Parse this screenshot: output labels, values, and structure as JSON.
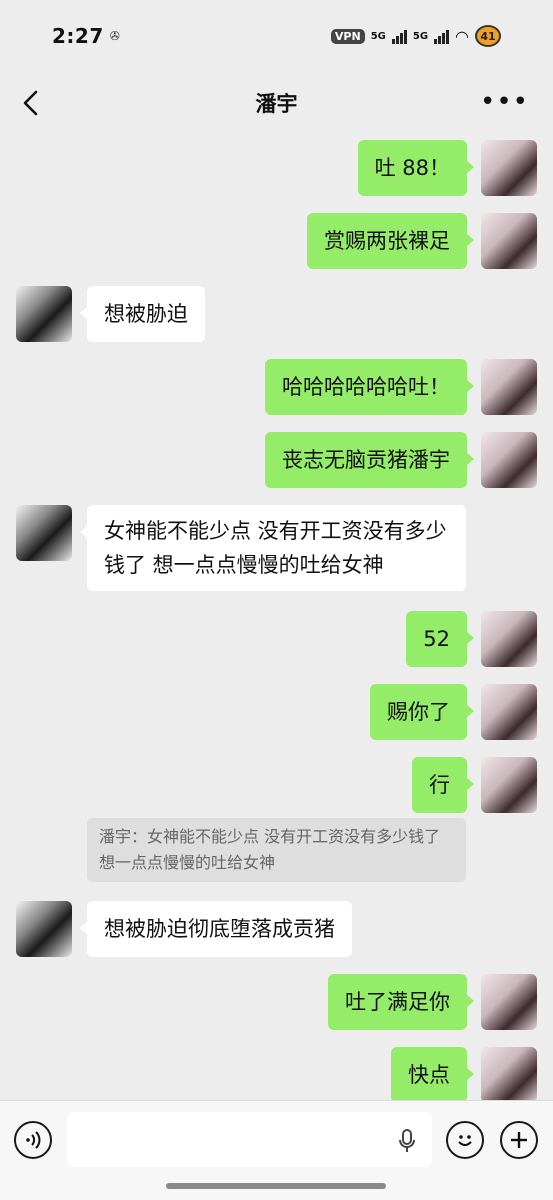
{
  "status": {
    "time": "2:27",
    "vpn": "VPN",
    "net1": "5G",
    "net2": "5G",
    "battery": "41"
  },
  "header": {
    "title": "潘宇"
  },
  "messages": [
    {
      "side": "out",
      "text": "吐 88！"
    },
    {
      "side": "out",
      "text": "赏赐两张裸足"
    },
    {
      "side": "in",
      "text": "想被胁迫"
    },
    {
      "side": "out",
      "text": "哈哈哈哈哈哈吐！"
    },
    {
      "side": "out",
      "text": "丧志无脑贡猪潘宇"
    },
    {
      "side": "in",
      "text": "女神能不能少点 没有开工资没有多少钱了 想一点点慢慢的吐给女神"
    },
    {
      "side": "out",
      "text": "52"
    },
    {
      "side": "out",
      "text": "赐你了"
    },
    {
      "side": "out",
      "text": "行"
    },
    {
      "side": "in",
      "text": "想被胁迫彻底堕落成贡猪"
    },
    {
      "side": "out",
      "text": "吐了满足你"
    },
    {
      "side": "out",
      "text": "快点"
    }
  ],
  "quote": {
    "text": "潘宇：女神能不能少点 没有开工资没有多少钱了 想一点点慢慢的吐给女神"
  },
  "input": {
    "value": ""
  },
  "icons": {
    "back": "chevron-left-icon",
    "more": "more-dots-icon",
    "voice": "voice-icon",
    "mic": "microphone-icon",
    "emoji": "emoji-icon",
    "plus": "plus-icon"
  }
}
